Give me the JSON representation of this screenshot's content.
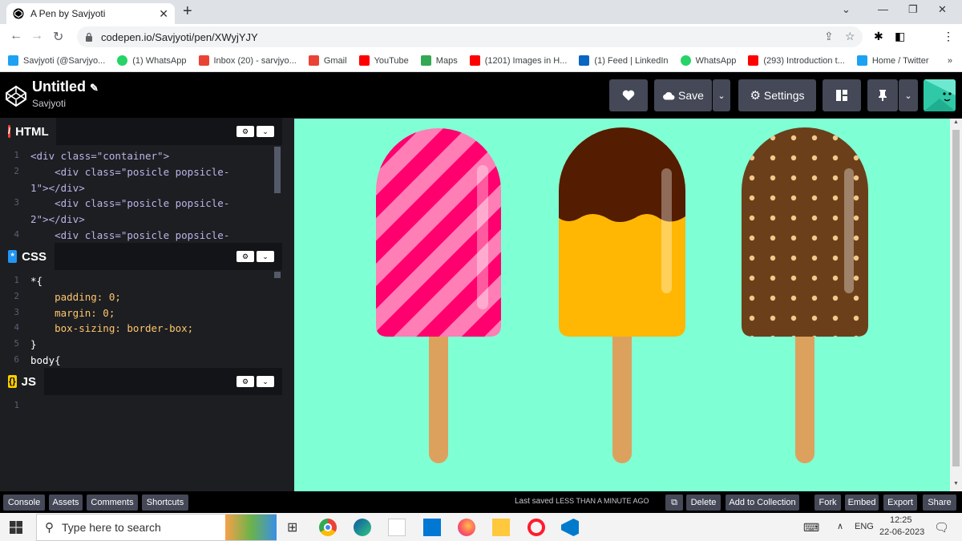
{
  "browser": {
    "tab_title": "A Pen by Savjyoti",
    "url": "codepen.io/Savjyoti/pen/XWyjYJY",
    "bookmarks": [
      {
        "label": "Savjyoti (@Sarvjyo...",
        "icon": "twitter-icon",
        "color": "#1da1f2"
      },
      {
        "label": "(1) WhatsApp",
        "icon": "whatsapp-icon",
        "color": "#25d366"
      },
      {
        "label": "Inbox (20) - sarvjyo...",
        "icon": "gmail-icon",
        "color": "#ea4335"
      },
      {
        "label": "Gmail",
        "icon": "gmail-icon",
        "color": "#ea4335"
      },
      {
        "label": "YouTube",
        "icon": "youtube-icon",
        "color": "#ff0000"
      },
      {
        "label": "Maps",
        "icon": "maps-icon",
        "color": "#34a853"
      },
      {
        "label": "(1201) Images in H...",
        "icon": "youtube-icon",
        "color": "#ff0000"
      },
      {
        "label": "(1) Feed | LinkedIn",
        "icon": "linkedin-icon",
        "color": "#0a66c2"
      },
      {
        "label": "WhatsApp",
        "icon": "whatsapp-icon",
        "color": "#25d366"
      },
      {
        "label": "(293) Introduction t...",
        "icon": "youtube-icon",
        "color": "#ff0000"
      },
      {
        "label": "Home / Twitter",
        "icon": "twitter-icon",
        "color": "#1da1f2"
      }
    ],
    "more": "»"
  },
  "header": {
    "title": "Untitled",
    "author": "Savjyoti",
    "save_label": "Save",
    "settings_label": "Settings"
  },
  "editors": {
    "html": {
      "label": "HTML",
      "lines": [
        {
          "num": "1",
          "text": "<div class=\"container\">"
        },
        {
          "num": "2",
          "text": "    <div class=\"posicle popsicle-"
        },
        {
          "num": "",
          "text": "1\"></div>"
        },
        {
          "num": "3",
          "text": "    <div class=\"posicle popsicle-"
        },
        {
          "num": "",
          "text": "2\"></div>"
        },
        {
          "num": "4",
          "text": "    <div class=\"posicle popsicle-"
        }
      ]
    },
    "css": {
      "label": "CSS",
      "lines": [
        {
          "num": "1",
          "text": "*{"
        },
        {
          "num": "2",
          "text": "    padding: 0;"
        },
        {
          "num": "3",
          "text": "    margin: 0;"
        },
        {
          "num": "4",
          "text": "    box-sizing: border-box;"
        },
        {
          "num": "5",
          "text": "}"
        },
        {
          "num": "6",
          "text": "body{"
        }
      ]
    },
    "js": {
      "label": "JS",
      "lines": [
        {
          "num": "1",
          "text": ""
        }
      ]
    }
  },
  "footer": {
    "left_buttons": [
      "Console",
      "Assets",
      "Comments",
      "Shortcuts"
    ],
    "saved_prefix": "Last saved",
    "saved_time": "LESS THAN A MINUTE AGO",
    "right_buttons": [
      "Delete",
      "Add to Collection",
      "Fork",
      "Embed",
      "Export",
      "Share"
    ]
  },
  "taskbar": {
    "search_placeholder": "Type here to search",
    "lang": "ENG",
    "time": "12:25",
    "date": "22-06-2023"
  },
  "colors": {
    "preview_bg": "#7fffd4",
    "pink": "#ff006e",
    "pink_stripe": "#ff7eb6",
    "chocolate_top": "#541c00",
    "mango": "#ffb703",
    "choco_body": "#6b3f1a",
    "stick": "#dda15e"
  }
}
